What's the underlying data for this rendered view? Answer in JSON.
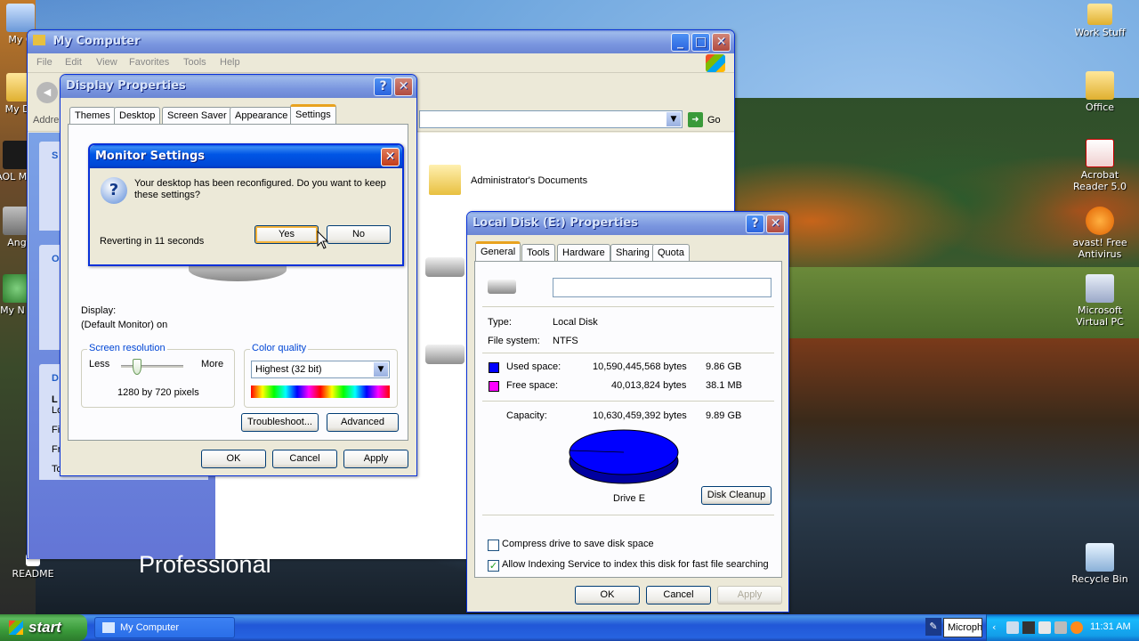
{
  "desktop": {
    "icons_left": [
      {
        "label": "My C",
        "name": "my-computer-desktop-icon"
      },
      {
        "label": "My Do",
        "name": "my-documents-desktop-icon"
      },
      {
        "label": "AOL Mes",
        "name": "aol-messenger-desktop-icon"
      },
      {
        "label": "Ang",
        "name": "ang-desktop-icon"
      },
      {
        "label": "My N P",
        "name": "my-network-places-desktop-icon"
      },
      {
        "label": "README",
        "name": "readme-desktop-icon"
      }
    ],
    "icons_right": [
      {
        "label": "Work Stuff",
        "name": "work-stuff-folder-icon"
      },
      {
        "label": "Office",
        "name": "office-icon"
      },
      {
        "label": "Acrobat Reader 5.0",
        "name": "acrobat-reader-icon"
      },
      {
        "label": "avast! Free Antivirus",
        "name": "avast-antivirus-icon"
      },
      {
        "label": "Microsoft Virtual PC",
        "name": "virtual-pc-icon"
      },
      {
        "label": "Recycle Bin",
        "name": "recycle-bin-icon"
      }
    ],
    "edition_text": "Professional"
  },
  "my_computer": {
    "title": "My Computer",
    "menu": [
      "File",
      "Edit",
      "View",
      "Favorites",
      "Tools",
      "Help"
    ],
    "address_label": "Addre",
    "go_label": "Go",
    "items": [
      {
        "label": "Administrator's Documents"
      }
    ],
    "left_pane_fragments": [
      "S",
      "O",
      "D",
      "L",
      "Lo",
      "Fi",
      "Fr",
      "To"
    ]
  },
  "display_properties": {
    "title": "Display Properties",
    "tabs": [
      "Themes",
      "Desktop",
      "Screen Saver",
      "Appearance",
      "Settings"
    ],
    "active_tab": "Settings",
    "display_label": "Display:",
    "display_value": "(Default Monitor) on",
    "resolution_group": "Screen resolution",
    "less": "Less",
    "more": "More",
    "resolution_value": "1280 by 720 pixels",
    "resolution_slider_level": 0.25,
    "color_group": "Color quality",
    "color_value": "Highest (32 bit)",
    "troubleshoot": "Troubleshoot...",
    "advanced": "Advanced",
    "ok": "OK",
    "cancel": "Cancel",
    "apply": "Apply"
  },
  "monitor_settings": {
    "title": "Monitor Settings",
    "message": "Your desktop has been reconfigured.  Do you want to keep these settings?",
    "reverting": "Reverting in 11 seconds",
    "yes": "Yes",
    "no": "No"
  },
  "disk_properties": {
    "title": "Local Disk (E:) Properties",
    "tabs": [
      "General",
      "Tools",
      "Hardware",
      "Sharing",
      "Quota"
    ],
    "active_tab": "General",
    "label_value": "",
    "type_label": "Type:",
    "type_value": "Local Disk",
    "fs_label": "File system:",
    "fs_value": "NTFS",
    "used_label": "Used space:",
    "used_bytes": "10,590,445,568 bytes",
    "used_size": "9.86 GB",
    "free_label": "Free space:",
    "free_bytes": "40,013,824 bytes",
    "free_size": "38.1 MB",
    "capacity_label": "Capacity:",
    "capacity_bytes": "10,630,459,392 bytes",
    "capacity_size": "9.89 GB",
    "drive_label": "Drive E",
    "disk_cleanup": "Disk Cleanup",
    "compress": "Compress drive to save disk space",
    "compress_checked": false,
    "indexing": "Allow Indexing Service to index this disk for fast file searching",
    "indexing_checked": true,
    "ok": "OK",
    "cancel": "Cancel",
    "apply": "Apply",
    "colors": {
      "used": "#0000ff",
      "free": "#ff00ff"
    }
  },
  "taskbar": {
    "start": "start",
    "task_label": "My Computer",
    "tray_app": "Microph",
    "clock": "11:31 AM"
  }
}
